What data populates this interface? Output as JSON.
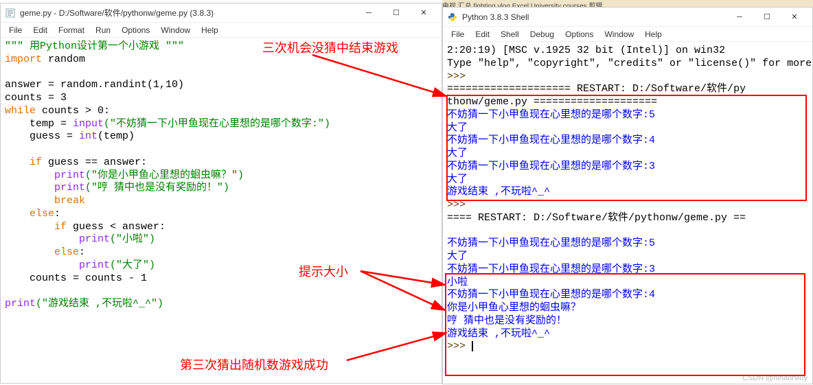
{
  "topstrip": "电视        汇总        fighting vlog        Excel        University courses        剪辑",
  "editor": {
    "title": "geme.py - D:/Software/软件/pythonw/geme.py (3.8.3)",
    "menus": [
      "File",
      "Edit",
      "Format",
      "Run",
      "Options",
      "Window",
      "Help"
    ],
    "code": {
      "l1_docstr": "\"\"\" 用Python设计第一个小游戏 \"\"\"",
      "l2_import": "import",
      "l2_mod": " random",
      "l4": "answer = random.randint(1,10)",
      "l5": "counts = 3",
      "l6_kw": "while",
      "l6_rest": " counts > 0:",
      "l7a": "    temp = ",
      "l7_input": "input",
      "l7_str": "(\"不妨猜一下小甲鱼现在心里想的是哪个数字:\")",
      "l8a": "    guess = ",
      "l8_int": "int",
      "l8b": "(temp)",
      "l10a": "    ",
      "l10_if": "if",
      "l10b": " guess == answer:",
      "l11a": "        ",
      "l11_print": "print",
      "l11_str": "(\"你是小甲鱼心里想的蛔虫嘛？\")",
      "l12a": "        ",
      "l12_print": "print",
      "l12_str": "(\"哼 猜中也是没有奖励的！\")",
      "l13a": "        ",
      "l13_break": "break",
      "l14a": "    ",
      "l14_else": "else",
      "l14b": ":",
      "l15a": "        ",
      "l15_if": "if",
      "l15b": " guess < answer:",
      "l16a": "            ",
      "l16_print": "print",
      "l16_str": "(\"小啦\")",
      "l17a": "        ",
      "l17_else": "else",
      "l17b": ":",
      "l18a": "            ",
      "l18_print": "print",
      "l18_str": "(\"大了\")",
      "l19": "    counts = counts - 1",
      "l21_print": "print",
      "l21_str": "(\"游戏结束 ,不玩啦^_^\")"
    }
  },
  "shell": {
    "title": "Python 3.8.3 Shell",
    "menus": [
      "File",
      "Edit",
      "Shell",
      "Debug",
      "Options",
      "Window",
      "Help"
    ],
    "head1": "2:20:19) [MSC v.1925 32 bit (Intel)] on win32",
    "head2": "Type \"help\", \"copyright\", \"credits\" or \"license()\" for more information.",
    "prompt": ">>>",
    "restart1a": "==================== RESTART: D:/Software/软件/py",
    "restart1b": "thonw/geme.py ====================",
    "run1": {
      "p1": "不妨猜一下小甲鱼现在心里想的是哪个数字:5",
      "r1": "大了",
      "p2": "不妨猜一下小甲鱼现在心里想的是哪个数字:4",
      "r2": "大了",
      "p3": "不妨猜一下小甲鱼现在心里想的是哪个数字:3",
      "r3": "大了",
      "end": "游戏结束 ,不玩啦^_^"
    },
    "restart2": "==== RESTART: D:/Software/软件/pythonw/geme.py ==",
    "run2": {
      "p1": "不妨猜一下小甲鱼现在心里想的是哪个数字:5",
      "r1": "大了",
      "p2": "不妨猜一下小甲鱼现在心里想的是哪个数字:3",
      "r2": "小啦",
      "p3": "不妨猜一下小甲鱼现在心里想的是哪个数字:4",
      "r3": "你是小甲鱼心里想的蛔虫嘛？",
      "r4": "哼 猜中也是没有奖励的！",
      "end": "游戏结束 ,不玩啦^_^"
    }
  },
  "annotations": {
    "a1": "三次机会没猜中结束游戏",
    "a2": "提示大小",
    "a3": "第三次猜出随机数游戏成功"
  },
  "watermark": "CSDN @nihaoniluy"
}
